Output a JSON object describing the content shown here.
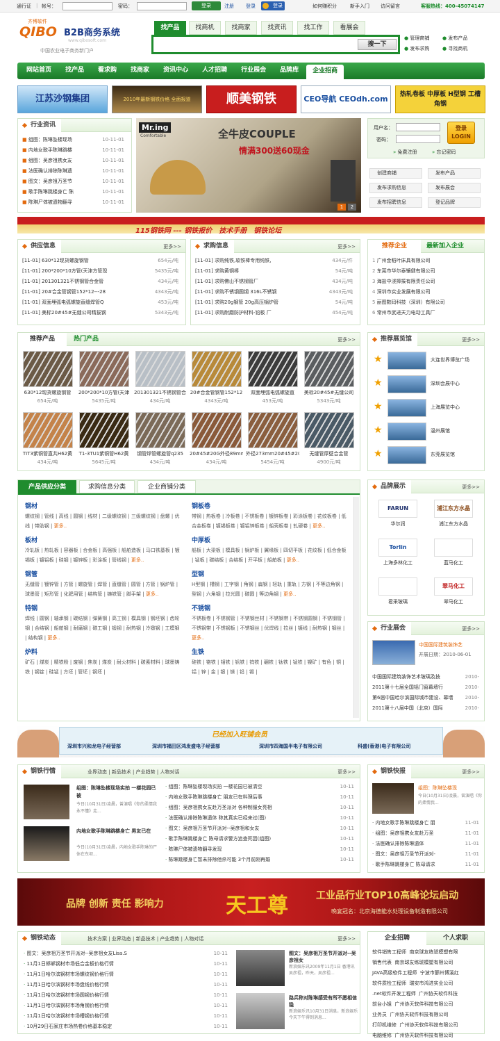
{
  "topbar": {
    "pass_label": "通行证",
    "account_label": "帐号：",
    "password_label": "密码：",
    "login_btn": "登录",
    "register": "注册",
    "sep": "|",
    "login": "登录",
    "qq_login": "登录",
    "links": [
      "如何赚积分",
      "新手入门",
      "访问留言"
    ],
    "hotline": "客服热线：400-45074147"
  },
  "logo": {
    "brand_small": "齐博软件",
    "brand": "QIBO",
    "title": "B2B商务系统",
    "url": "www.qibosoft.com",
    "slogan": "中国农业电子商务新门户"
  },
  "search": {
    "tabs": [
      "找产品",
      "找商机",
      "找商家",
      "找资讯",
      "找工作",
      "看展会"
    ],
    "button": "搜一下",
    "links": [
      "管理商铺",
      "发布产品",
      "发布求购",
      "寻找商机"
    ]
  },
  "nav": {
    "items": [
      "网站首页",
      "找产品",
      "看求购",
      "找商家",
      "资讯中心",
      "人才招聘",
      "行业展会",
      "品牌库",
      "企业招商"
    ]
  },
  "banners": [
    "江苏沙钢集团",
    "2010年最新钢铁价格 全面报道",
    "顺美钢铁",
    "CEO导航 CEOdh.com",
    "热轧卷板 中厚板 H型钢 工槽角钢"
  ],
  "news_box": {
    "title": "行业资讯",
    "items": [
      {
        "t": "组图：陈琳坠楼现场",
        "d": "10-11-01"
      },
      {
        "t": "内地女歌手陈琳跳楼",
        "d": "10-11-01"
      },
      {
        "t": "组图：吴彦祖携女友",
        "d": "10-11-01"
      },
      {
        "t": "法医确认排除陈琳遗",
        "d": "10-11-01"
      },
      {
        "t": "图文：吴彦祖万圣节",
        "d": "10-11-01"
      },
      {
        "t": "歌手陈琳跳楼身亡 陈",
        "d": "10-11-01"
      },
      {
        "t": "陈琳尸体被遗物翻寻",
        "d": "10-11-01"
      }
    ]
  },
  "slideshow": {
    "brand": "Mr.ing",
    "sub": "Comfortable",
    "headline": "全牛皮COUPLE",
    "promo": "情满300送60现金",
    "pages": [
      "1",
      "2"
    ]
  },
  "login_box": {
    "user_label": "用户名：",
    "pass_label": "密码：",
    "login_btn": "登录 LOGIN",
    "register": "免费注册",
    "forgot": "忘记密码",
    "buttons": [
      "创建商铺",
      "发布产品",
      "发布求购信息",
      "发布展会",
      "发布招聘信息",
      "登记品牌"
    ]
  },
  "wide_banner": {
    "text": "115钢铁网 --- 钢铁报价　技术手册　钢铁论坛"
  },
  "supply": {
    "title": "供应信息",
    "more": "更多>>",
    "items": [
      {
        "t": "[11-01] 630*12现货螺旋钢管",
        "p": "654元/吨"
      },
      {
        "t": "[11-01] 200*200*10方管(天津方管现",
        "p": "5435元/吨"
      },
      {
        "t": "[11-01] 201301321不锈钢管合金管",
        "p": "434元/吨"
      },
      {
        "t": "[11-01] 20#合金管钢管152*12---28",
        "p": "4343元/吨"
      },
      {
        "t": "[11-01] 双面埋弧电弧螺旋直缝焊管Q",
        "p": "453元/吨"
      },
      {
        "t": "[11-01] 美标20#45#无缝公司精拔钢",
        "p": "5343元/吨"
      }
    ]
  },
  "buy": {
    "title": "求购信息",
    "more": "更多>>",
    "items": [
      {
        "t": "[11-01] 求购纯铁,软铁棒专用纯铁,",
        "p": "434元/件"
      },
      {
        "t": "[11-01] 求购黄铜棒",
        "p": "54元/吨"
      },
      {
        "t": "[11-01] 求购佛山不锈钢管厂",
        "p": "434元/吨"
      },
      {
        "t": "[11-01] 求购不锈钢圆钢 316L不锈钢",
        "p": "4343元/吨"
      },
      {
        "t": "[11-01] 求购20g钢管 20g高压锅炉管",
        "p": "54元/吨"
      },
      {
        "t": "[11-01] 求购耐磨防护材料-铅板  厂",
        "p": "454元/吨"
      }
    ]
  },
  "companies": {
    "tab1": "推荐企业",
    "tab2": "最新加入企业",
    "items": [
      "广州金稻叶床具有限公司",
      "东莞市华尔泰镶健有限公司",
      "海盐中浇捧揍有限责任公司",
      "深圳市实业发展有限公司",
      "丽图数码科技（深圳）有限公司",
      "常州市武进天力电动工具厂"
    ]
  },
  "products": {
    "tab1": "推荐产品",
    "tab2": "热门产品",
    "more": "更多>>",
    "items": [
      {
        "n": "630*12现货螺旋钢管",
        "p": "654元/吨",
        "c": "#6b5a46"
      },
      {
        "n": "200*200*10方管(天津",
        "p": "5435元/吨",
        "c": "#8a6a5a"
      },
      {
        "n": "201301321不锈钢管合",
        "p": "434元/吨",
        "c": "#b8bfc6"
      },
      {
        "n": "20#合金管钢管152*12",
        "p": "4343元/吨",
        "c": "#b88a3a"
      },
      {
        "n": "双面埋弧电弧螺旋直",
        "p": "453元/吨",
        "c": "#3c3c3c"
      },
      {
        "n": "美标20#45#无缝公司",
        "p": "5343元/吨",
        "c": "#5a5d60"
      },
      {
        "n": "TIT3紫铜管直共H62黄",
        "p": "434元/吨",
        "c": "#c4834a"
      },
      {
        "n": "T1-3TU1紫铜管H62黄",
        "p": "5645元/吨",
        "c": "#3a2a14"
      },
      {
        "n": "钢管焊管螺旋管q235",
        "p": "434元/吨",
        "c": "#7b6a58"
      },
      {
        "n": "20#45#20G外径89mm小",
        "p": "434元/吨",
        "c": "#8a5a3a"
      },
      {
        "n": "外径273mm20#45#20G",
        "p": "5454元/吨",
        "c": "#8a5e3e"
      },
      {
        "n": "无缝管厚壁合金管",
        "p": "4900元/吨",
        "c": "#4a5a66"
      }
    ]
  },
  "expo": {
    "title": "推荐展览馆",
    "more": "更多>>",
    "items": [
      "大连世界博览广场",
      "深圳会展中心",
      "上海展览中心",
      "温州展馆",
      "东莞展览馆"
    ]
  },
  "categories": {
    "tabs": [
      "产品供应分类",
      "求购信息分类",
      "企业商铺分类"
    ],
    "left": [
      {
        "h": "钢材",
        "t": "螺纹钢 | 管线 | 高线 | 圆钢 | 线材 | 二级螺纹钢 | 三级螺纹钢 | 盘螺 | 优线 | 带肋钢 |",
        "m": "更多.."
      },
      {
        "h": "板材",
        "t": "冷轧板 | 热轧板 | 容器板 | 合金板 | 高强板 | 船舶造板 | 马口铁基板 | 镀锡板 | 镀铝板 | 硅钢 | 镀锌板 | 彩涂板 | 管线钢 |",
        "m": "更多.."
      },
      {
        "h": "钢管",
        "t": "无缝管 | 镀锌管 | 方管 | 螺旋管 | 焊管 | 直缝管 | 圆管 | 方管 | 锅炉管 | 球墨管 | 矩形管 | 化肥用管 | 结构管 | 铸铁管 | 脚手架 |",
        "m": "更多.."
      },
      {
        "h": "特钢",
        "t": "焊线 | 圆钢 | 轴承钢 | 碳结钢 | 弹簧钢 | 高工钢 | 模具钢 | 钢坯钢 | 齿轮钢 | 合结钢 | 船舶钢 | 耐磨钢 | 碳工钢 | 锻钢 | 耐热钢 | 冷镦钢 | 工模钢 | 结构钢 |",
        "m": "更多.."
      },
      {
        "h": "炉料",
        "t": "矿石 | 煤炭 | 精铁粉 | 废钢 | 焦炭 | 煤炭 | 耐火材料 | 碳素材料 | 球墨铸铁 | 钢锭 | 硅锰 | 方坯 | 管坯 | 钢坯 |",
        "m": ""
      }
    ],
    "right": [
      {
        "h": "钢板卷",
        "t": "带钢 | 热板卷 | 冷板卷 | 不锈板卷 | 镀锌板卷 | 彩涂板卷 | 花纹板卷 | 低合金板卷 | 镀锡板卷 | 镀铝锌板卷 | 船壳板卷 | 轧硬卷 |",
        "m": "更多.."
      },
      {
        "h": "中厚板",
        "t": "船板 | 大梁板 | 模具板 | 锅炉板 | 翼缘板 | 四切平板 | 花纹板 | 低合金板 | 锰板 | 碳结板 | 合结板 | 开平板 | 船舶板 |",
        "m": "更多.."
      },
      {
        "h": "型钢",
        "t": "H型钢 | 槽钢 | 工字钢 | 角钢 | 扁钢 | 轻轨 | 重轨 | 方钢 | 不等边角钢 | 型钢 | 六角钢 | 拉光圆 | 碳圆 | 等边角钢 |",
        "m": "更多.."
      },
      {
        "h": "不锈钢",
        "t": "不锈板卷 | 不锈钢管 | 不锈钢丝材 | 不锈钢带 | 不锈钢圆钢 | 不锈钢管 | 不锈钢带 | 不锈钢板 | 不锈钢丝 | 优焊线 | 拉丝 | 镀线 | 耐热钢 | 钢丝 |",
        "m": "更多.."
      },
      {
        "h": "生铁",
        "t": "硅铁 | 铬铁 | 钼铁 | 钒铁 | 钨铁 | 硼铁 | 钛铁 | 锰铁 | 镍矿 | 有色 | 铜 | 铝 | 锌 | 金 | 银 | 镁 | 铅 | 锡 |",
        "m": ""
      }
    ]
  },
  "brands": {
    "title": "品牌展示",
    "more": "更多>>",
    "items": [
      {
        "logo": "FARUN",
        "n": "华尔润",
        "c": "#1d2f6b"
      },
      {
        "logo": "浦江东方水晶",
        "n": "浦江东方水晶",
        "c": "#8a4a18"
      },
      {
        "logo": "Torlin",
        "n": "上海多林化工",
        "c": "#1a4fa0"
      },
      {
        "logo": "",
        "n": "蓝马化工",
        "c": "#4a7ab0"
      },
      {
        "logo": "",
        "n": "君采玻璃",
        "c": "#2a8a3a"
      },
      {
        "logo": "翠马化工",
        "n": "翠马化工",
        "c": "#c02020"
      }
    ]
  },
  "fairs": {
    "title": "行业展会",
    "more": "更多>>",
    "feat": "中国国际建筑装饰艺",
    "date": "开展日期：2010-06-01",
    "items": [
      {
        "t": "中国国际建筑装饰艺术玻璃及技",
        "d": "2010-"
      },
      {
        "t": "2011第十七届全国铝门窗幕墙行",
        "d": "2010-"
      },
      {
        "t": "第6届中国哈尔滨国际城市建设、幕墙",
        "d": "2010-"
      },
      {
        "t": "2011第十八届中国（北京）国际",
        "d": "2010-"
      }
    ]
  },
  "member_banner": {
    "title": "已经加入旺铺会员",
    "items": [
      "深圳市兴和龙电子经营部",
      "深圳市福田区鸿发盛电子经营部",
      "深圳市四海国半电子有限公司",
      "科盛(香港)电子有限公司"
    ]
  },
  "steel_story": {
    "title": "钢铁行情",
    "tabs": [
      "业界动态",
      "新品技术",
      "产业趋势",
      "人物对话"
    ],
    "more": "更多>>",
    "feat": [
      {
        "t": "组图：陈琳坠楼现场实拍 一楼花园已被",
        "s": "今日(10月31日)凌晨，曾演唱《你的柔情我永不懂》走..."
      },
      {
        "t": "内地女歌手陈琳跳楼身亡 男友已在",
        "s": "今日(10月31日)凌晨，内地女歌手陈琳的尸体在东坝..."
      }
    ],
    "items": [
      {
        "t": "组图：陈琳坠楼现场实拍 一楼花园已被清空",
        "d": "10-11"
      },
      {
        "t": "内地女歌手陈琳跳楼身亡 朋友已在料理后事",
        "d": "10-11"
      },
      {
        "t": "组图：吴彦祖携女友赴万圣派对 各种制服女亮相",
        "d": "10-11"
      },
      {
        "t": "法医确认排除陈琳遗体 称其真实已经来过(图)",
        "d": "10-11"
      },
      {
        "t": "图文：吴彦祖万圣节开派对--吴彦祖和女友",
        "d": "10-11"
      },
      {
        "t": "歌手陈琳跳楼身亡 陈母请求警方追查死因(组图)",
        "d": "10-11"
      },
      {
        "t": "陈琳尸体被遗物翻寻发现",
        "d": "10-11"
      },
      {
        "t": "陈琳跳楼身亡暂未排除他杀可能 3个月前刚再婚",
        "d": "10-11"
      }
    ]
  },
  "steel_news": {
    "title": "钢铁快报",
    "more": "更多>>",
    "feat": "组图：陈琳坠楼现",
    "sub": "今日(10月31日)凌晨，曾演唱《你的柔情我...",
    "items": [
      {
        "t": "内地女歌手陈琳跳楼身亡 朋",
        "d": "11-01"
      },
      {
        "t": "组图：吴彦祖携女友赴万圣",
        "d": "11-01"
      },
      {
        "t": "法医确认排除陈琳遗体",
        "d": "11-01"
      },
      {
        "t": "图文：吴彦祖万圣节开派对-",
        "d": "11-01"
      },
      {
        "t": "歌手陈琳跳楼身亡 陈母请求",
        "d": "11-01"
      }
    ]
  },
  "red_banner": {
    "left": "品牌 创新 责任 影响力",
    "big": "天工尊",
    "right": "工业品行业TOP10高峰论坛启动",
    "sub": "晚宴冠名：北京海德能水处理设备制造有限公司"
  },
  "steel_dyn": {
    "title": "钢铁动态",
    "tabs": [
      "技术方案",
      "业界动态",
      "新品技术",
      "产业趋势",
      "人物对话"
    ],
    "more": "更多>>",
    "items": [
      {
        "t": "图文：吴彦祖万圣节开派对--吴彦祖女友Lisa.S",
        "d": "10-11"
      },
      {
        "t": "11月1日邯郸钢材市场低合金板价格行情",
        "d": "10-11"
      },
      {
        "t": "11月1日哈尔滨钢材市场螺纹钢价格行情",
        "d": "10-11"
      },
      {
        "t": "11月1日哈尔滨钢材市场盘线价格行情",
        "d": "10-11"
      },
      {
        "t": "11月1日哈尔滨钢材市场圆钢价格行情",
        "d": "10-11"
      },
      {
        "t": "11月1日哈尔滨钢材市场角钢价格行情",
        "d": "10-11"
      },
      {
        "t": "11月1日哈尔滨钢材市场槽钢价格行情",
        "d": "10-11"
      },
      {
        "t": "10月29日石家庄市场热卷价格基本稳定",
        "d": "10-11"
      }
    ],
    "feat": [
      {
        "t": "图文：吴彦祖万圣节开派对--吴彦祖女",
        "s": "新浪娱乐讯2009年11月1日 香港讯吴彦祖，昨天，吴彦祖..."
      },
      {
        "t": "路兵称对陈琳感受有所不愿相信隐",
        "s": "新浪娱乐讯10月31日消息，新浪娱乐今天下午得到消息..."
      }
    ]
  },
  "jobs": {
    "tab1": "企业招聘",
    "tab2": "个人求职",
    "items": [
      {
        "j": "软件销售工程师",
        "c": "南京球友练琥模塑有限"
      },
      {
        "j": "销售代表",
        "c": "南京球友练琥模塑有限公司"
      },
      {
        "j": "JAVA高级软件工程师",
        "c": "宁波市鄞州博溪红"
      },
      {
        "j": "软件质检工程师",
        "c": "瑞安市鸿进实业公司"
      },
      {
        "j": ".net软件开发工程师",
        "c": "广州协天软件科技"
      },
      {
        "j": "前台小姐",
        "c": "广州协天软件科技有限公司"
      },
      {
        "j": "业务员",
        "c": "广州协天软件科技有限公司"
      },
      {
        "j": "打印机维修",
        "c": "广州协天软件科技有限公司"
      },
      {
        "j": "电脑维修",
        "c": "广州协天软件科技有限公司"
      }
    ]
  }
}
